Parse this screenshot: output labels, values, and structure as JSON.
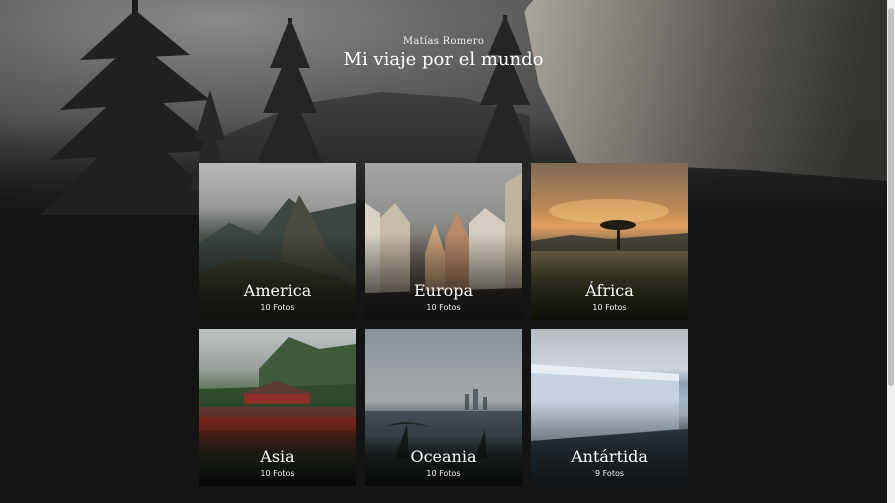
{
  "header": {
    "author": "Matías Romero",
    "title": "Mi viaje por el mundo"
  },
  "gallery": [
    {
      "name": "America",
      "count": "10 Fotos",
      "scene": "mountain-ruins"
    },
    {
      "name": "Europa",
      "count": "10 Fotos",
      "scene": "old-town"
    },
    {
      "name": "África",
      "count": "10 Fotos",
      "scene": "savanna-sunset"
    },
    {
      "name": "Asia",
      "count": "10 Fotos",
      "scene": "temple"
    },
    {
      "name": "Oceania",
      "count": "10 Fotos",
      "scene": "bay-palms"
    },
    {
      "name": "Antártida",
      "count": "9 Fotos",
      "scene": "ice-shelf"
    }
  ]
}
